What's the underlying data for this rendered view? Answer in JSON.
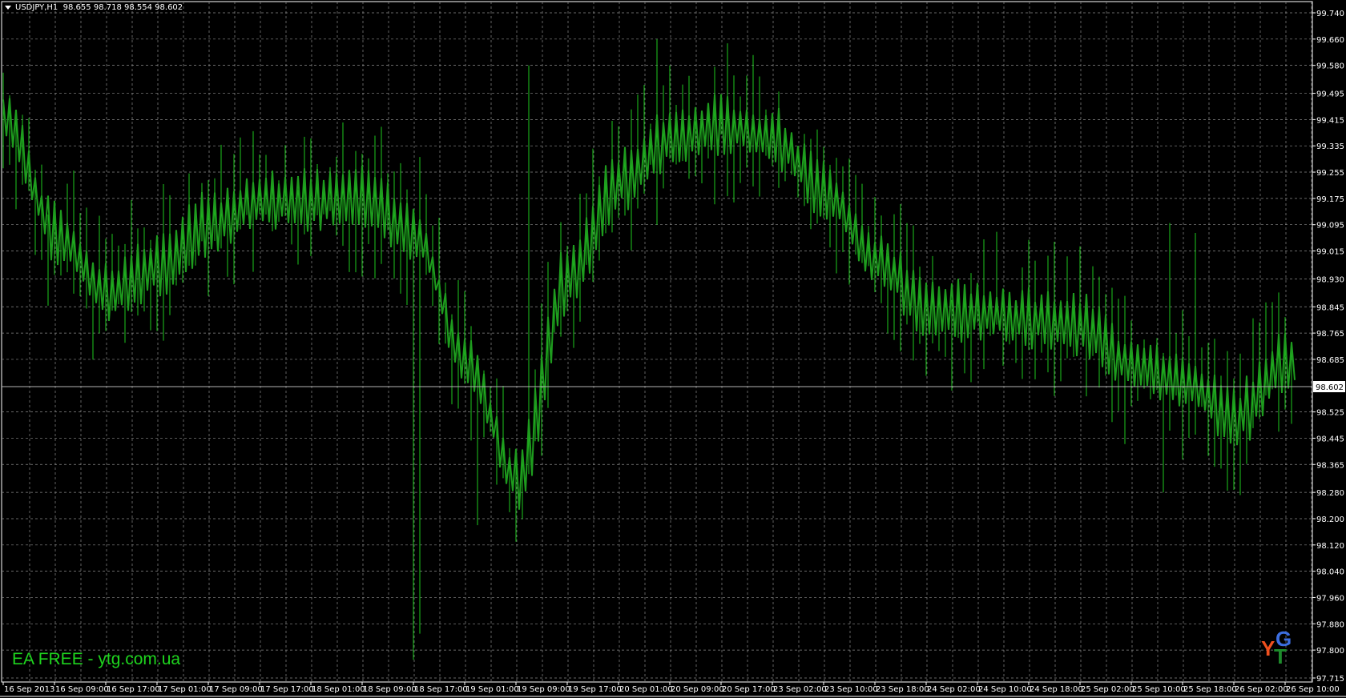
{
  "header": {
    "symbol": "USDJPY,H1",
    "ohlc": "98.655 98.718 98.554 98.602"
  },
  "watermark": "EA FREE - ytg.com.ua",
  "logo": {
    "letters": [
      "Y",
      "G",
      "T"
    ],
    "colors": [
      "#f0501e",
      "#3c6ee0",
      "#1e8c2c"
    ]
  },
  "colors": {
    "background": "#000000",
    "grid": "#8c8c8c",
    "bars": "#1ec81e",
    "line": "#1e9c1e",
    "axis_text": "#ffffff",
    "price_line": "#b4b4b4"
  },
  "chart_data": {
    "type": "bar",
    "title": "USDJPY,H1",
    "ylim": [
      97.715,
      99.74
    ],
    "y_ticks": [
      "99.740",
      "99.660",
      "99.580",
      "99.495",
      "99.415",
      "99.335",
      "99.255",
      "99.175",
      "99.095",
      "99.015",
      "98.930",
      "98.845",
      "98.765",
      "98.685",
      "98.525",
      "98.445",
      "98.365",
      "98.280",
      "98.200",
      "98.120",
      "98.040",
      "97.960",
      "97.880",
      "97.800",
      "97.715"
    ],
    "current_price": "98.602",
    "x_ticks": [
      "16 Sep 2013",
      "16 Sep 09:00",
      "16 Sep 17:00",
      "17 Sep 01:00",
      "17 Sep 09:00",
      "17 Sep 17:00",
      "18 Sep 01:00",
      "18 Sep 09:00",
      "18 Sep 17:00",
      "19 Sep 01:00",
      "19 Sep 09:00",
      "19 Sep 17:00",
      "20 Sep 01:00",
      "20 Sep 09:00",
      "20 Sep 17:00",
      "23 Sep 02:00",
      "23 Sep 10:00",
      "23 Sep 18:00",
      "24 Sep 02:00",
      "24 Sep 10:00",
      "24 Sep 18:00",
      "25 Sep 02:00",
      "25 Sep 10:00",
      "25 Sep 18:00",
      "26 Sep 02:00",
      "26 Sep 10:00"
    ],
    "bars_per_tick": 8,
    "close_at_ticks": [
      99.42,
      99.07,
      98.89,
      98.97,
      99.1,
      99.17,
      99.17,
      99.18,
      99.07,
      98.68,
      98.32,
      98.94,
      99.23,
      99.36,
      99.4,
      99.36,
      99.2,
      98.99,
      98.84,
      98.83,
      98.81,
      98.79,
      98.67,
      98.62,
      98.51,
      98.68
    ],
    "extremes": [
      {
        "bar": 64,
        "low": 97.77
      },
      {
        "bar": 65,
        "low": 97.85
      },
      {
        "bar": 82,
        "high": 99.58
      },
      {
        "bar": 102,
        "high": 99.66
      },
      {
        "bar": 104,
        "high": 99.58
      },
      {
        "bar": 141,
        "high": 99.1
      },
      {
        "bar": 181,
        "low": 98.28
      },
      {
        "bar": 182,
        "high": 99.1
      },
      {
        "bar": 186,
        "high": 99.07
      },
      {
        "bar": 74,
        "low": 98.18
      }
    ]
  }
}
